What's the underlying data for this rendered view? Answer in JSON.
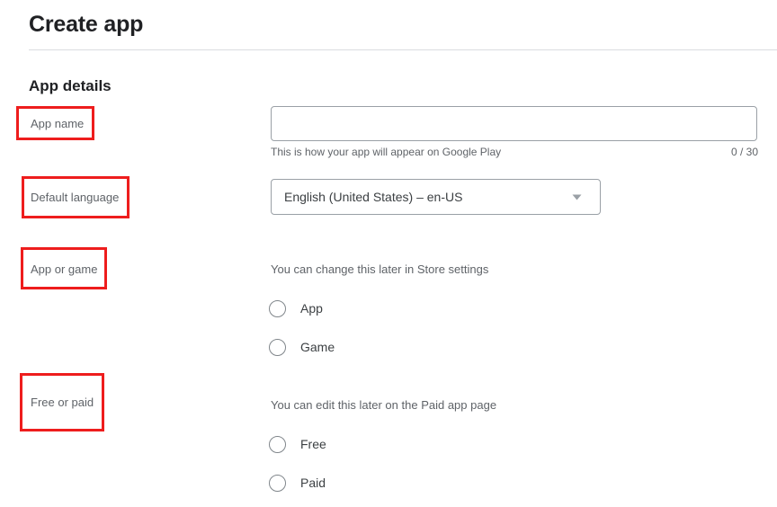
{
  "header": {
    "title": "Create app"
  },
  "section": {
    "heading": "App details"
  },
  "fields": {
    "app_name": {
      "label": "App name",
      "value": "",
      "placeholder": "",
      "helper_text": "This is how your app will appear on Google Play",
      "counter": "0 / 30",
      "max_length": 30
    },
    "default_language": {
      "label": "Default language",
      "selected": "English (United States) – en-US",
      "arrow_icon": "chevron-down-icon"
    },
    "app_or_game": {
      "label": "App or game",
      "note": "You can change this later in Store settings",
      "options": [
        {
          "label": "App",
          "selected": false
        },
        {
          "label": "Game",
          "selected": false
        }
      ]
    },
    "free_or_paid": {
      "label": "Free or paid",
      "note": "You can edit this later on the Paid app page",
      "options": [
        {
          "label": "Free",
          "selected": false
        },
        {
          "label": "Paid",
          "selected": false
        }
      ]
    }
  },
  "annotations": {
    "highlight_color": "#ee1d1d",
    "boxes": [
      {
        "target": "App name"
      },
      {
        "target": "Default language"
      },
      {
        "target": "App or game"
      },
      {
        "target": "Free or paid"
      }
    ]
  },
  "colors": {
    "text_primary": "#202124",
    "text_secondary": "#5f6368",
    "border": "#9aa0a6",
    "divider": "#dadce0",
    "background": "#ffffff"
  }
}
